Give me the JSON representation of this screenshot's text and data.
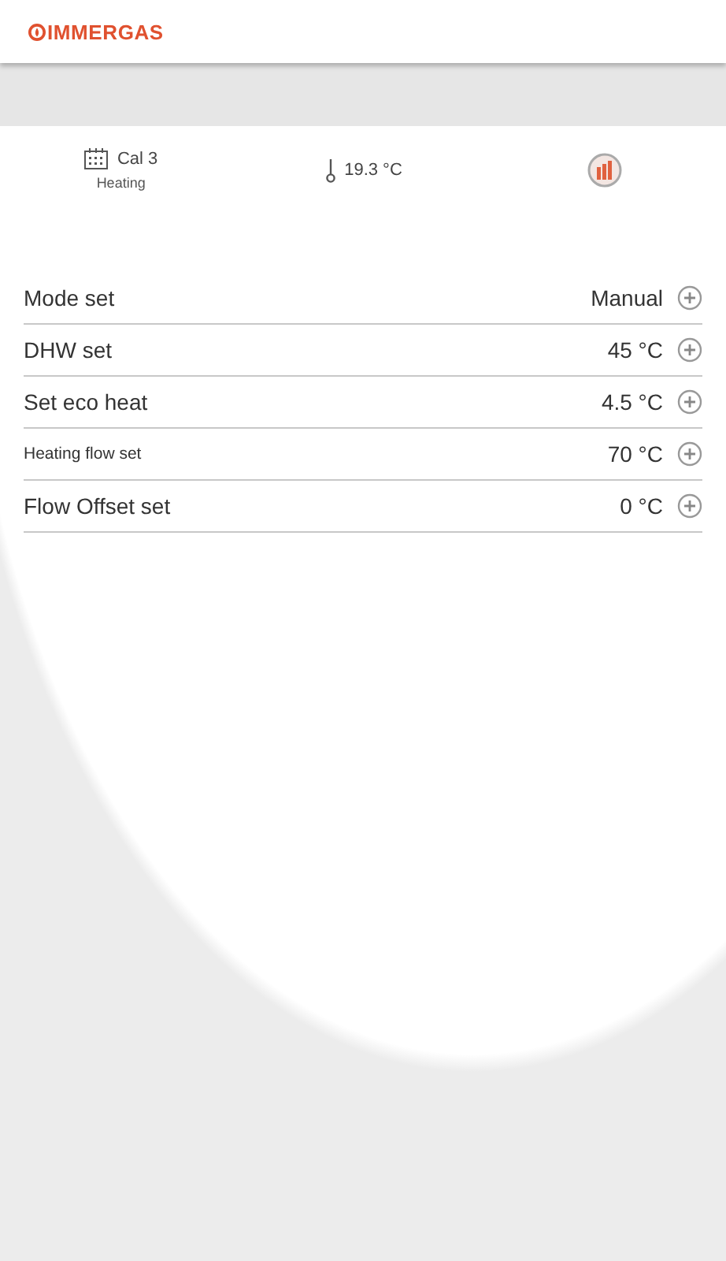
{
  "header": {
    "logo": "IMMERGAS"
  },
  "status": {
    "calendar": "Cal 3",
    "mode": "Heating",
    "temperature": "19.3 °C"
  },
  "settings": [
    {
      "label": "Mode set",
      "value": "Manual",
      "kind": "normal"
    },
    {
      "label": "DHW set",
      "value": "45 °C",
      "kind": "normal"
    },
    {
      "label": "Set eco heat",
      "value": "4.5 °C",
      "kind": "normal"
    },
    {
      "label": "Heating flow set",
      "value": "70 °C",
      "kind": "compact"
    },
    {
      "label": "Flow Offset set",
      "value": "0 °C",
      "kind": "normal"
    }
  ]
}
